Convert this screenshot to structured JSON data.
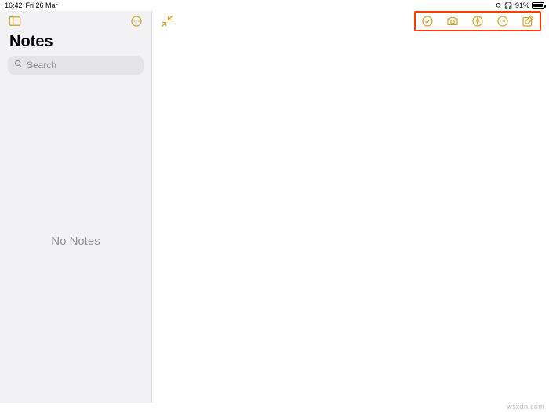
{
  "statusbar": {
    "time": "16:42",
    "date": "Fri 26 Mar",
    "battery_percent": "91%"
  },
  "sidebar": {
    "title": "Notes",
    "search_placeholder": "Search",
    "empty_text": "No Notes"
  },
  "toolbar": {
    "checklist_label": "Checklist",
    "camera_label": "Camera",
    "markup_label": "Markup",
    "more_label": "More",
    "compose_label": "New Note"
  },
  "accent": "#c9a227",
  "highlight_box": "#ff3b00",
  "watermark": "wsxdn.com"
}
